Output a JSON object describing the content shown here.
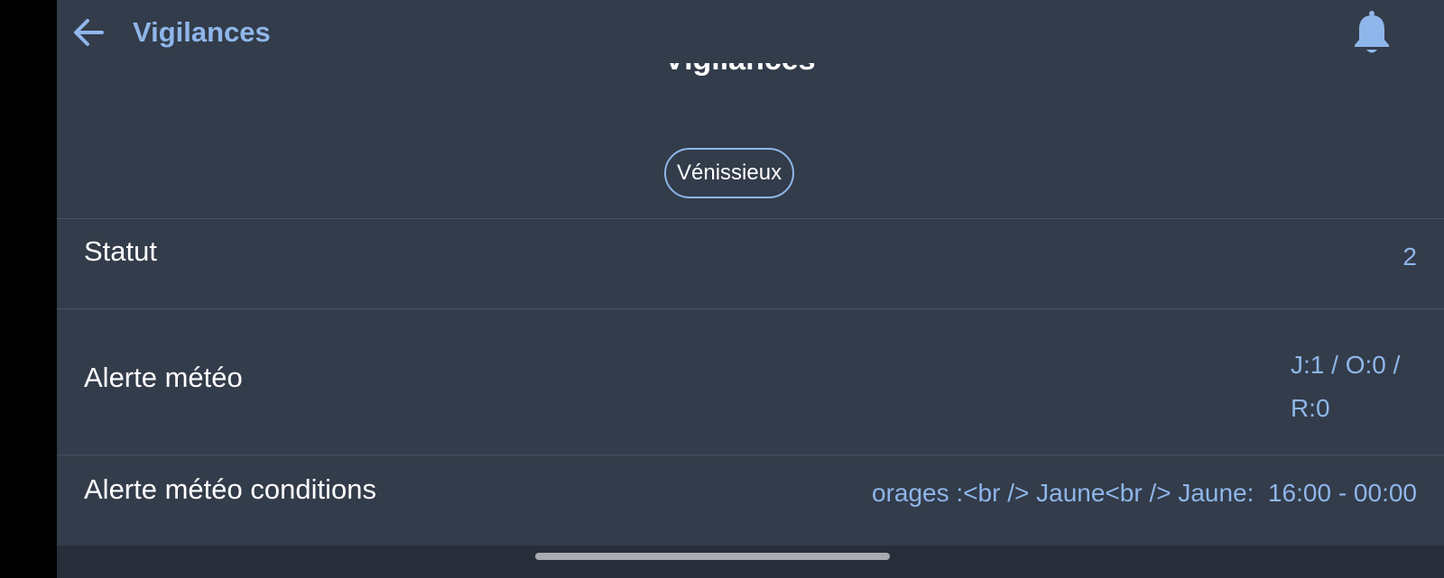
{
  "topbar": {
    "back_icon": "arrow-left-icon",
    "title": "Vigilances",
    "bell_icon": "bell-icon"
  },
  "header": {
    "name": "Vigilances",
    "city": "Vénissieux"
  },
  "rows": [
    {
      "label": "Statut",
      "value": "2"
    },
    {
      "label": "Alerte météo",
      "value": "J:1 / O:0 / R:0"
    },
    {
      "label": "Alerte météo conditions",
      "value": "orages :<br /> Jaune<br /> Jaune:  16:00 - 00:00"
    }
  ],
  "colors": {
    "background": "#333c4a",
    "accent": "#8fb6ea",
    "divider": "#475263",
    "text": "#ffffff"
  }
}
